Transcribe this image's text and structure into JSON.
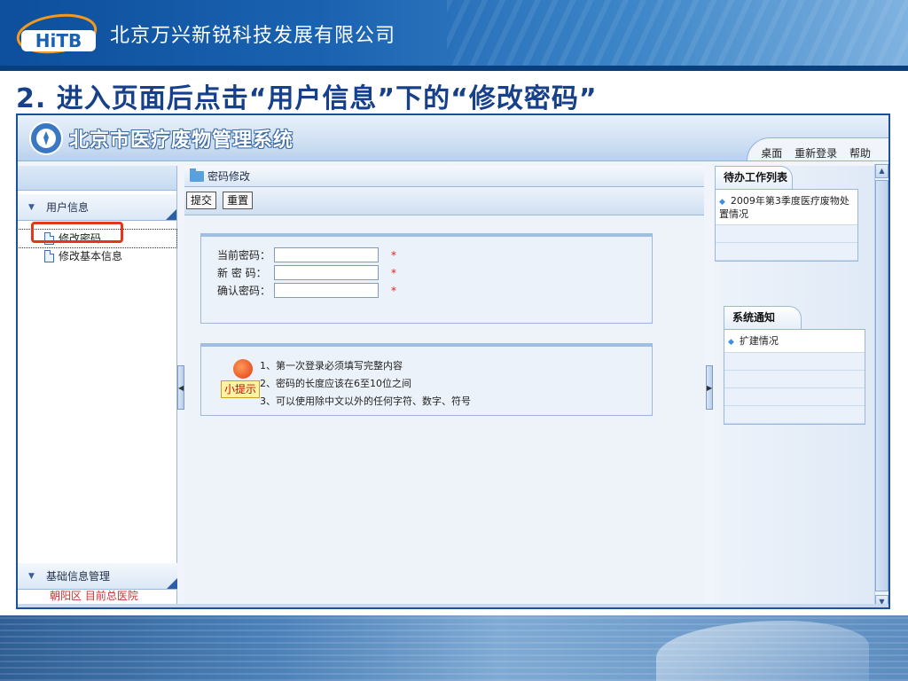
{
  "slide": {
    "company": "北京万兴新锐科技发展有限公司",
    "logo_text": "HiTB",
    "step_title": "2. 进入页面后点击“用户信息”下的“修改密码”"
  },
  "app": {
    "title": "北京市医疗废物管理系统",
    "header_links": [
      "桌面",
      "重新登录",
      "帮助"
    ]
  },
  "left_nav": {
    "section_user": "用户信息",
    "items": [
      {
        "label": "修改密码",
        "active": true
      },
      {
        "label": "修改基本信息",
        "active": false
      }
    ],
    "section_base": "基础信息管理",
    "cut_text": "朝阳区 目前总医院"
  },
  "main": {
    "breadcrumb": "密码修改",
    "buttons": {
      "submit": "提交",
      "reset": "重置"
    },
    "form": {
      "current_password": "当前密码：",
      "new_password": "新 密 码：",
      "confirm_password": "确认密码：",
      "required_mark": "*"
    },
    "tips": {
      "label": "小提示",
      "lines": [
        "1、第一次登录必须填写完整内容",
        "2、密码的长度应该在6至10位之间",
        "3、可以使用除中文以外的任何字符、数字、符号"
      ]
    }
  },
  "right_panel": {
    "todo_title": "待办工作列表",
    "todo_items": [
      "2009年第3季度医疗废物处置情况"
    ],
    "notice_title": "系统通知",
    "notice_items": [
      "扩建情况"
    ]
  },
  "colors": {
    "accent": "#1d4f9a",
    "highlight": "#e2371a",
    "title_blue": "#17408b"
  }
}
